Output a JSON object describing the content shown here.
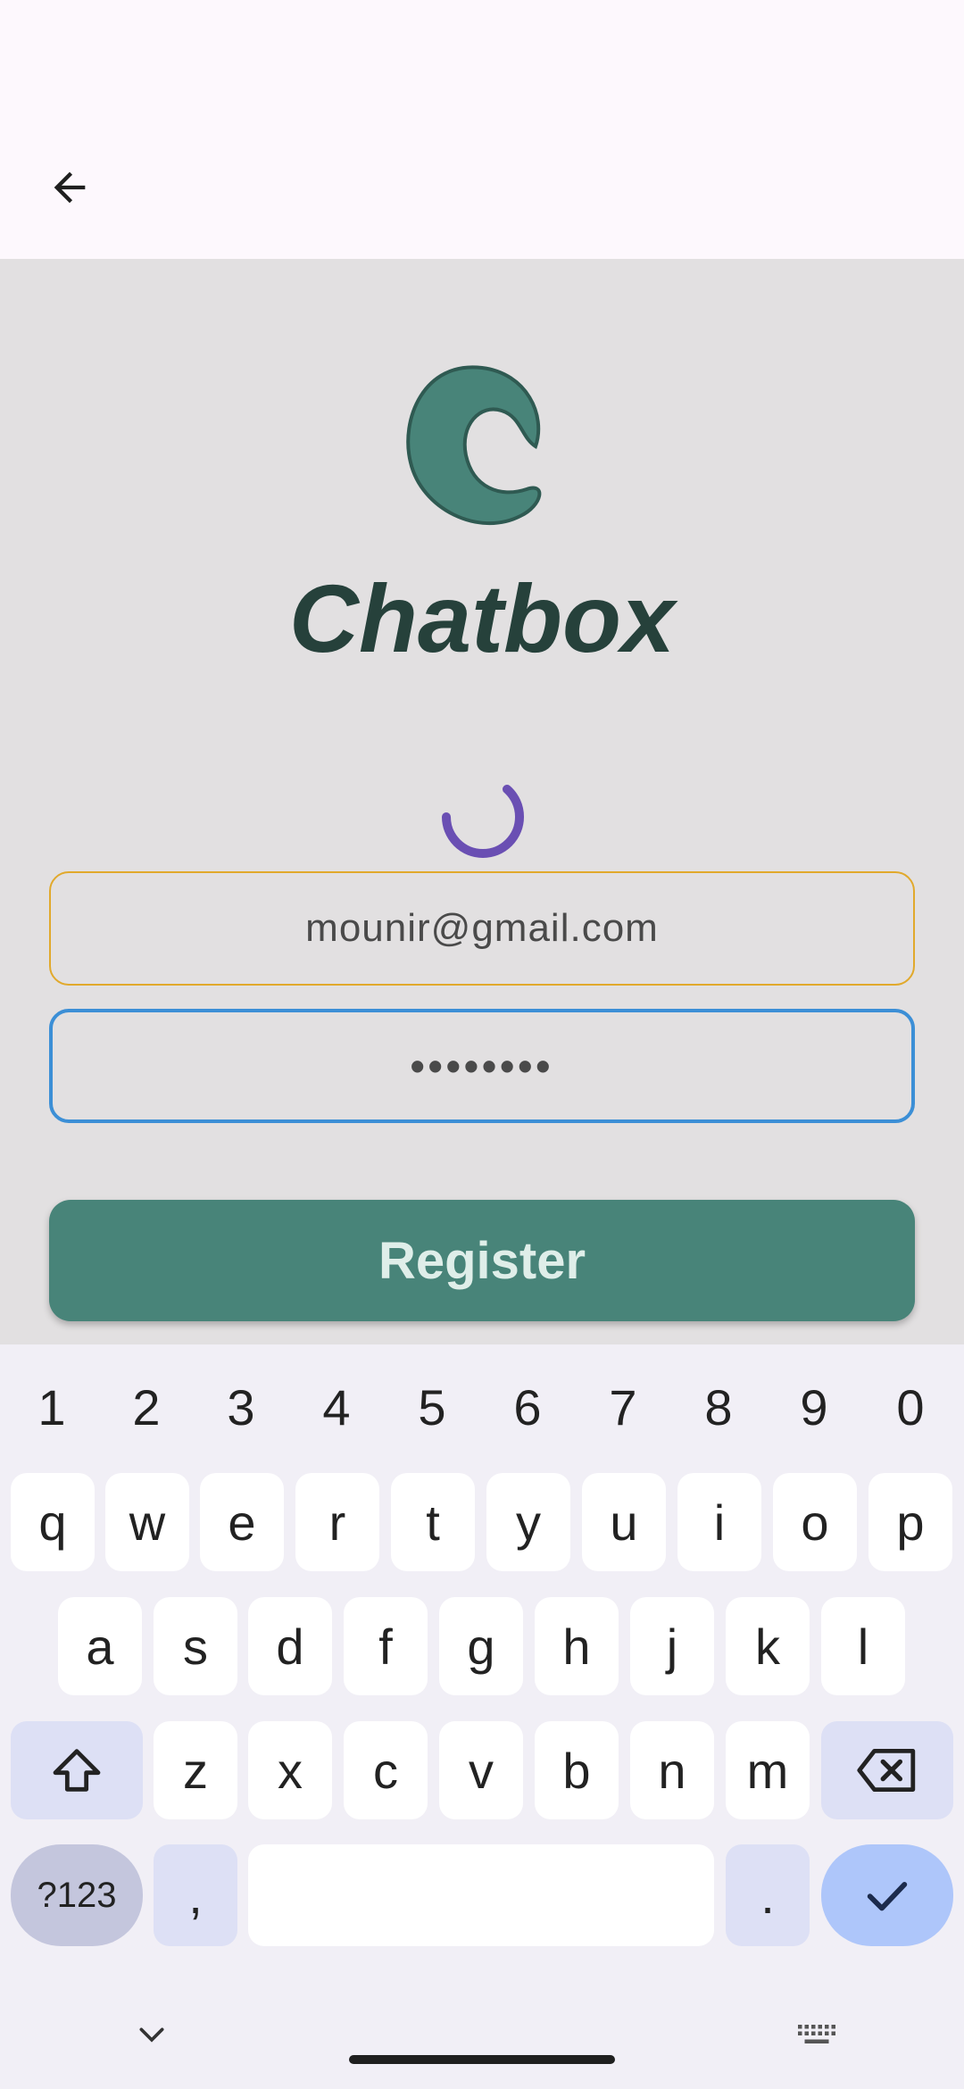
{
  "app": {
    "brand_name": "Chatbox",
    "accent_color": "#488479",
    "spinner_color": "#6a4fb3"
  },
  "app_bar": {
    "back_icon": "arrow-left-icon"
  },
  "form": {
    "email_value": "mounir@gmail.com",
    "password_value": "••••••••",
    "register_label": "Register"
  },
  "keyboard": {
    "numbers": [
      "1",
      "2",
      "3",
      "4",
      "5",
      "6",
      "7",
      "8",
      "9",
      "0"
    ],
    "row1": [
      "q",
      "w",
      "e",
      "r",
      "t",
      "y",
      "u",
      "i",
      "o",
      "p"
    ],
    "row2": [
      "a",
      "s",
      "d",
      "f",
      "g",
      "h",
      "j",
      "k",
      "l"
    ],
    "row3": [
      "z",
      "x",
      "c",
      "v",
      "b",
      "n",
      "m"
    ],
    "symbols_label": "?123",
    "comma_label": ",",
    "period_label": "."
  },
  "nav": {
    "hide_keyboard_icon": "chevron-down-icon",
    "switch_keyboard_icon": "keyboard-icon"
  }
}
